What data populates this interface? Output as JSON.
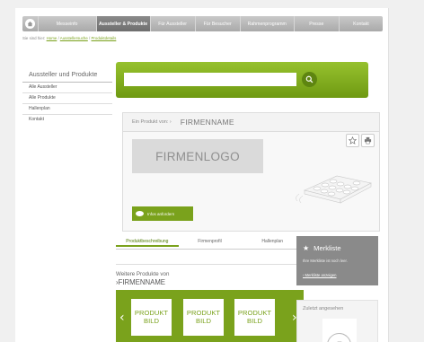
{
  "nav": {
    "items": [
      {
        "label": "Messeinfo",
        "width": 65,
        "active": false
      },
      {
        "label": "Aussteller & Produkte",
        "width": 60,
        "active": true
      },
      {
        "label": "Für Aussteller",
        "width": 50,
        "active": false
      },
      {
        "label": "Für Besucher",
        "width": 50,
        "active": false
      },
      {
        "label": "Rahmenprogramm",
        "width": 60,
        "active": false
      },
      {
        "label": "Presse",
        "width": 50,
        "active": false
      },
      {
        "label": "Kontakt",
        "width": 49,
        "active": false
      }
    ]
  },
  "breadcrumb": {
    "prefix": "Sie sind hier:",
    "items": [
      "Home",
      "Ausstellersuche",
      "Produktdetails"
    ],
    "separator": "/"
  },
  "sidebar": {
    "title": "Aussteller und Produkte",
    "items": [
      "Alle Aussteller",
      "Alle Produkte",
      "Hallenplan",
      "Kontakt"
    ]
  },
  "search": {
    "placeholder": "",
    "icon": "search-icon"
  },
  "product": {
    "from_label": "Ein Produkt von: ›",
    "company": "FIRMENNAME",
    "logo_text": "FIRMENLOGO",
    "info_button": "Infos anfordern"
  },
  "tabs": [
    "Produktbeschreibung",
    "Firmenprofil",
    "Hallenplan"
  ],
  "more_products": {
    "title": "Weitere Produkte von",
    "company": "›FIRMENNAME",
    "items": [
      {
        "line1": "PRODUKT",
        "line2": "BILD"
      },
      {
        "line1": "PRODUKT",
        "line2": "BILD"
      },
      {
        "line1": "PRODUKT",
        "line2": "BILD"
      }
    ]
  },
  "merkliste": {
    "title": "Merkliste",
    "text": "Ihre Merkliste ist noch leer.",
    "link": "› Merkliste anzeigen"
  },
  "recent": {
    "title": "Zuletzt angesehen"
  },
  "colors": {
    "accent": "#7aa21c",
    "nav": "#b8b8b8",
    "merkliste": "#8a8a8a"
  }
}
